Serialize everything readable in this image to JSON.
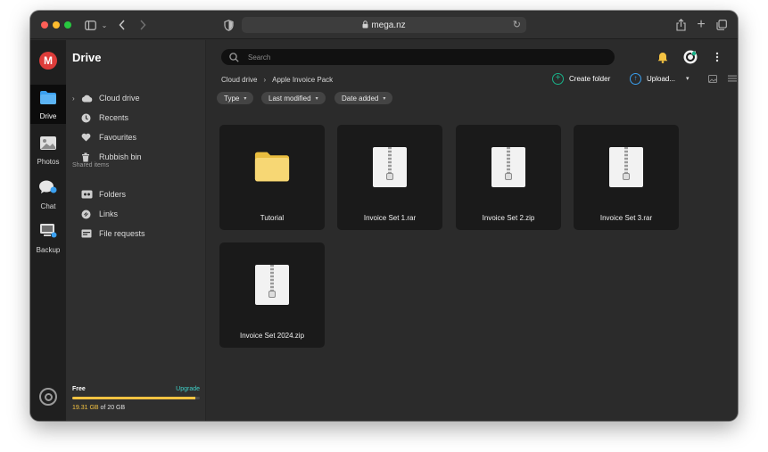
{
  "browser": {
    "url": "mega.nz"
  },
  "app": {
    "logo_letter": "M",
    "rail": [
      {
        "id": "drive",
        "label": "Drive"
      },
      {
        "id": "photos",
        "label": "Photos"
      },
      {
        "id": "chat",
        "label": "Chat"
      },
      {
        "id": "backup",
        "label": "Backup"
      }
    ]
  },
  "sidebar": {
    "title": "Drive",
    "items": [
      {
        "label": "Cloud drive",
        "icon": "cloud-icon"
      },
      {
        "label": "Recents",
        "icon": "clock-icon"
      },
      {
        "label": "Favourites",
        "icon": "heart-icon"
      },
      {
        "label": "Rubbish bin",
        "icon": "trash-icon"
      }
    ],
    "shared_title": "Shared items",
    "shared_items": [
      {
        "label": "Folders",
        "icon": "shared-folder-icon"
      },
      {
        "label": "Links",
        "icon": "link-icon"
      },
      {
        "label": "File requests",
        "icon": "file-request-icon"
      }
    ],
    "storage": {
      "plan": "Free",
      "upgrade": "Upgrade",
      "used": "19.31 GB",
      "total_text": "of 20 GB",
      "used_fraction": 0.9655
    }
  },
  "main": {
    "search_placeholder": "Search",
    "breadcrumb": [
      "Cloud drive",
      "Apple Invoice Pack"
    ],
    "actions": {
      "create_folder": "Create folder",
      "upload": "Upload..."
    },
    "filters": [
      "Type",
      "Last modified",
      "Date added"
    ],
    "files": [
      {
        "name": "Tutorial",
        "kind": "folder"
      },
      {
        "name": "Invoice Set 1.rar",
        "kind": "archive"
      },
      {
        "name": "Invoice Set 2.zip",
        "kind": "archive"
      },
      {
        "name": "Invoice Set 3.rar",
        "kind": "archive"
      },
      {
        "name": "Invoice Set 2024.zip",
        "kind": "archive"
      }
    ]
  },
  "colors": {
    "accent_red": "#dd3c3a",
    "storage_bar": "#f5c342",
    "upgrade_link": "#3fd0c8",
    "create_folder_icon": "#19b38a",
    "upload_icon": "#3aa0f0",
    "folder_yellow": "#f7d774",
    "bell": "#f5c342"
  }
}
